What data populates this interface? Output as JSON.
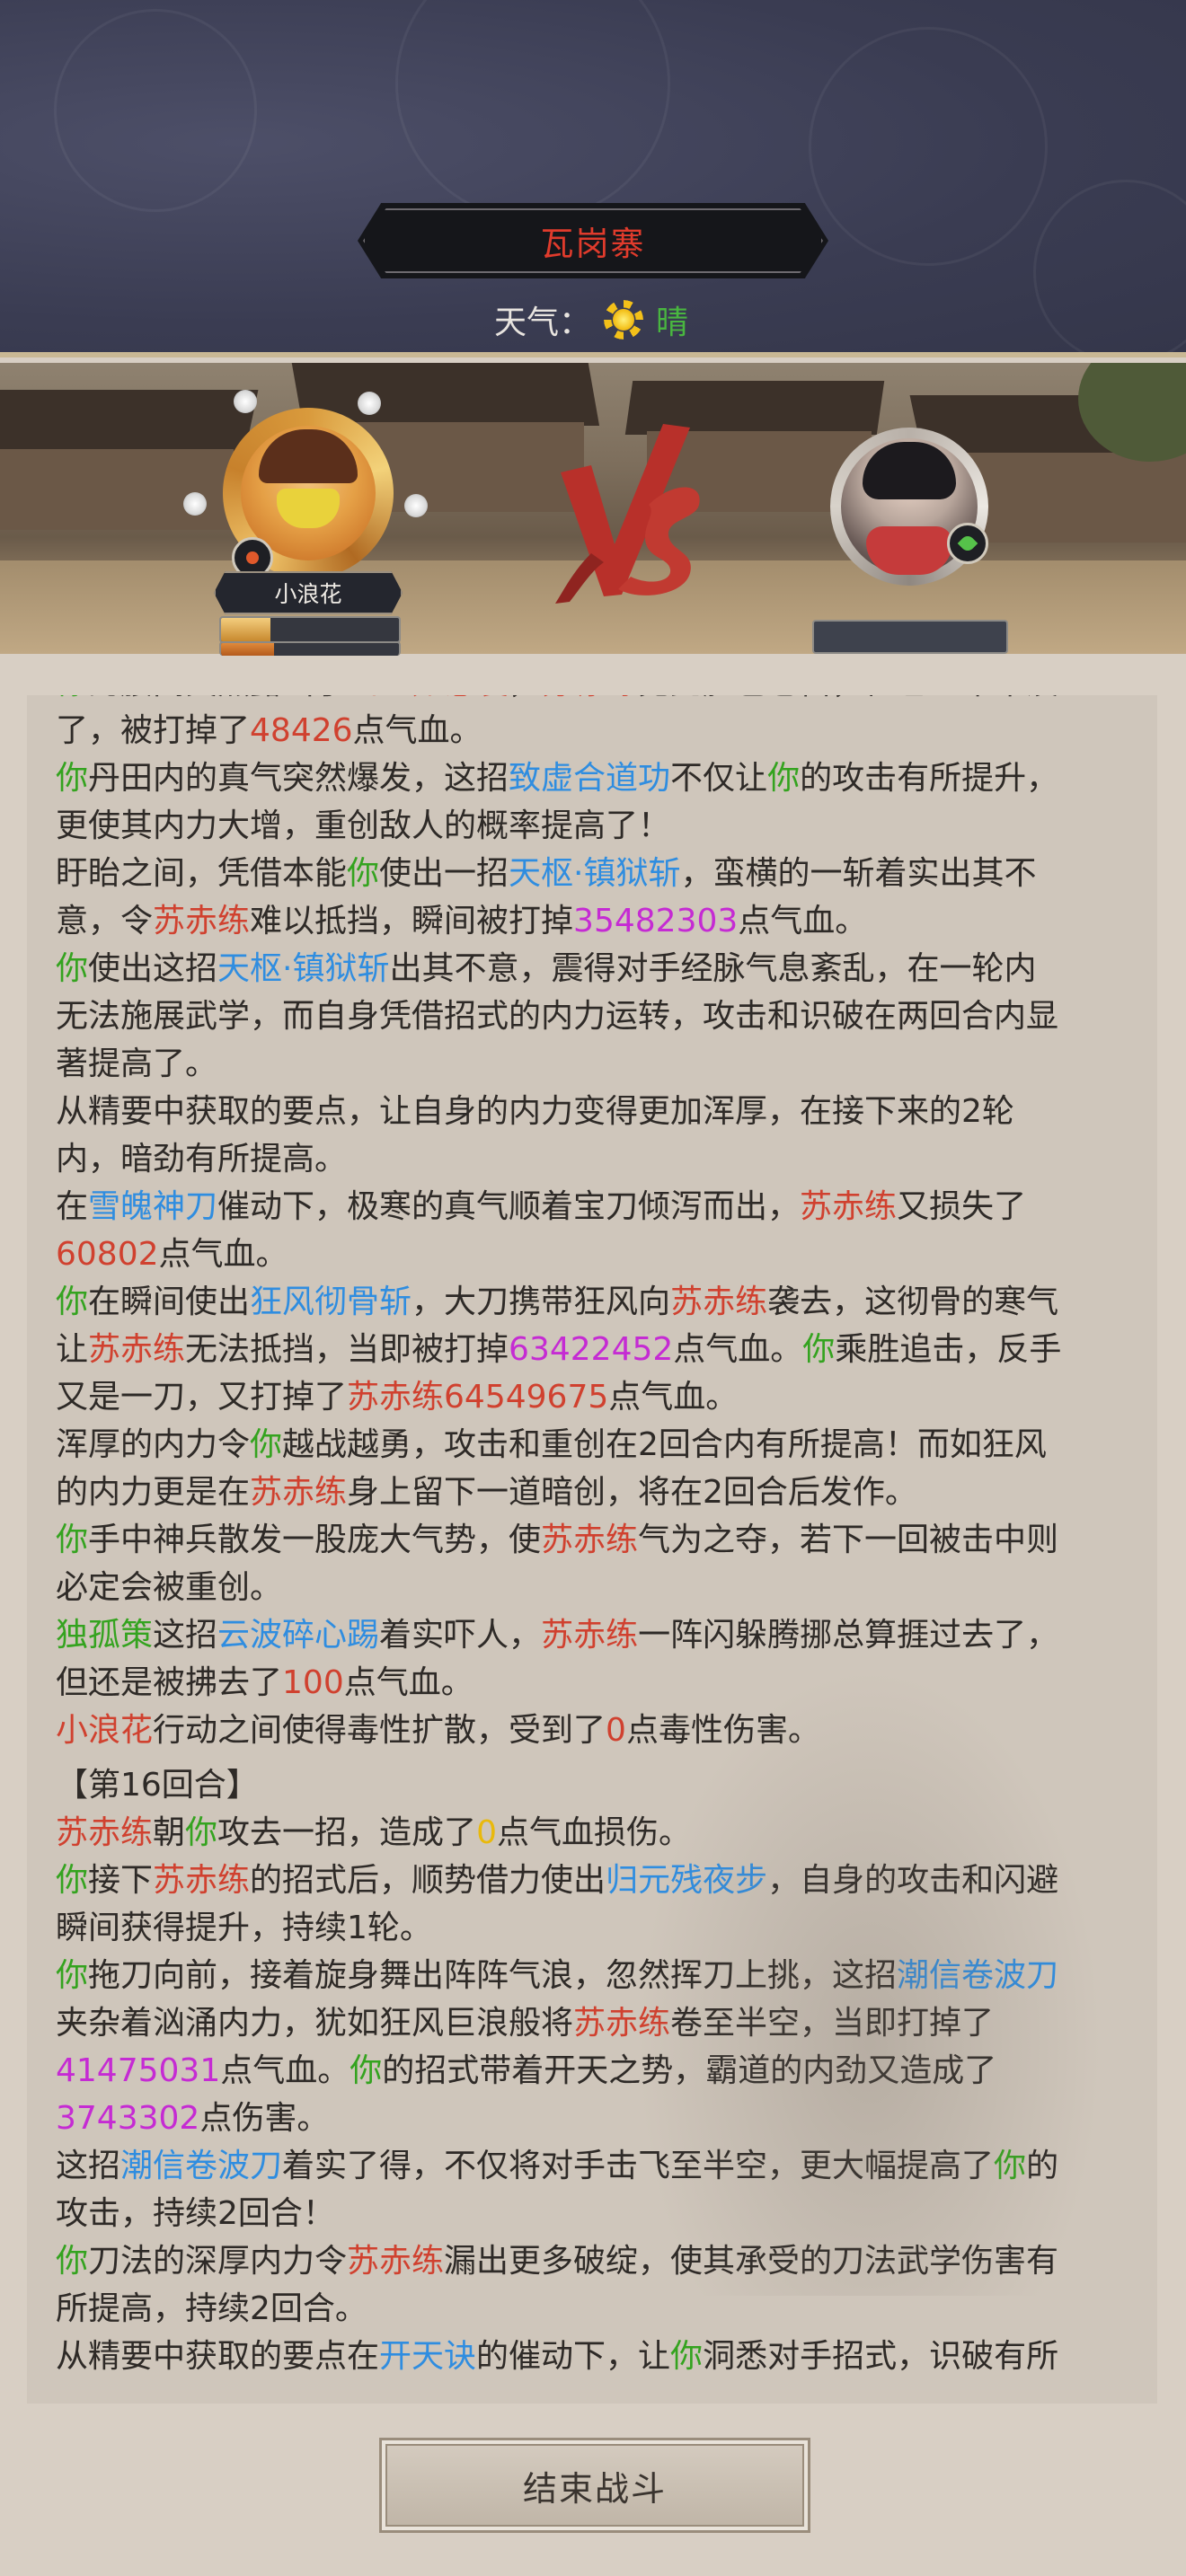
{
  "header": {
    "location": "瓦岗寨",
    "weather_label": "天气：",
    "weather_value": "晴",
    "weather_icon": "sun-icon"
  },
  "battle": {
    "player_name": "小浪花",
    "vs_label": "VS"
  },
  "colors": {
    "self": "#34a31f",
    "enemy": "#d0412f",
    "skill": "#2f8de0",
    "damage": "#c52bd3",
    "zero_damage": "#e9b90c"
  },
  "log": [
    [
      [
        "c-green",
        "你"
      ],
      [
        "",
        "的腰间突然露出了"
      ],
      [
        "c-red",
        "飞蝗如意囊"
      ],
      [
        "",
        "，"
      ],
      [
        "c-red",
        "苏赤练"
      ],
      [
        "",
        "见此脸色苍白，但已经来不及"
      ]
    ],
    [
      [
        "",
        "了，被打掉了"
      ],
      [
        "c-red",
        "48426"
      ],
      [
        "",
        "点气血。"
      ]
    ],
    [
      [
        "c-green",
        "你"
      ],
      [
        "",
        "丹田内的真气突然爆发，这招"
      ],
      [
        "c-blue",
        "致虚合道功"
      ],
      [
        "",
        "不仅让"
      ],
      [
        "c-green",
        "你"
      ],
      [
        "",
        "的攻击有所提升，"
      ]
    ],
    [
      [
        "",
        "更使其内力大增，重创敌人的概率提高了！"
      ]
    ],
    [
      [
        "",
        "盱眙之间，凭借本能"
      ],
      [
        "c-green",
        "你"
      ],
      [
        "",
        "使出一招"
      ],
      [
        "c-blue",
        "天枢·镇狱斩"
      ],
      [
        "",
        "，蛮横的一斩着实出其不"
      ]
    ],
    [
      [
        "",
        "意，令"
      ],
      [
        "c-red",
        "苏赤练"
      ],
      [
        "",
        "难以抵挡，瞬间被打掉"
      ],
      [
        "c-magenta",
        "35482303"
      ],
      [
        "",
        "点气血。"
      ]
    ],
    [
      [
        "c-green",
        "你"
      ],
      [
        "",
        "使出这招"
      ],
      [
        "c-blue",
        "天枢·镇狱斩"
      ],
      [
        "",
        "出其不意，震得对手经脉气息紊乱，在一轮内"
      ]
    ],
    [
      [
        "",
        "无法施展武学，而自身凭借招式的内力运转，攻击和识破在两回合内显"
      ]
    ],
    [
      [
        "",
        "著提高了。"
      ]
    ],
    [
      [
        "",
        "从精要中获取的要点，让自身的内力变得更加浑厚，在接下来的2轮"
      ]
    ],
    [
      [
        "",
        "内，暗劲有所提高。"
      ]
    ],
    [
      [
        "",
        "在"
      ],
      [
        "c-blue",
        "雪魄神刀"
      ],
      [
        "",
        "催动下，极寒的真气顺着宝刀倾泻而出，"
      ],
      [
        "c-red",
        "苏赤练"
      ],
      [
        "",
        "又损失了"
      ]
    ],
    [
      [
        "c-red",
        "60802"
      ],
      [
        "",
        "点气血。"
      ]
    ],
    [
      [
        "c-green",
        "你"
      ],
      [
        "",
        "在瞬间使出"
      ],
      [
        "c-blue",
        "狂风彻骨斩"
      ],
      [
        "",
        "，大刀携带狂风向"
      ],
      [
        "c-red",
        "苏赤练"
      ],
      [
        "",
        "袭去，这彻骨的寒气"
      ]
    ],
    [
      [
        "",
        "让"
      ],
      [
        "c-red",
        "苏赤练"
      ],
      [
        "",
        "无法抵挡，当即被打掉"
      ],
      [
        "c-magenta",
        "63422452"
      ],
      [
        "",
        "点气血。"
      ],
      [
        "c-green",
        "你"
      ],
      [
        "",
        "乘胜追击，反手"
      ]
    ],
    [
      [
        "",
        "又是一刀，又打掉了"
      ],
      [
        "c-red",
        "苏赤练64549675"
      ],
      [
        "",
        "点气血。"
      ]
    ],
    [
      [
        "",
        "浑厚的内力令"
      ],
      [
        "c-green",
        "你"
      ],
      [
        "",
        "越战越勇，攻击和重创在2回合内有所提高！而如狂风"
      ]
    ],
    [
      [
        "",
        "的内力更是在"
      ],
      [
        "c-red",
        "苏赤练"
      ],
      [
        "",
        "身上留下一道暗创，将在2回合后发作。"
      ]
    ],
    [
      [
        "c-green",
        "你"
      ],
      [
        "",
        "手中神兵散发一股庞大气势，使"
      ],
      [
        "c-red",
        "苏赤练"
      ],
      [
        "",
        "气为之夺，若下一回被击中则"
      ]
    ],
    [
      [
        "",
        "必定会被重创。"
      ]
    ],
    [
      [
        "c-green",
        "独孤策"
      ],
      [
        "",
        "这招"
      ],
      [
        "c-blue",
        "云波碎心踢"
      ],
      [
        "",
        "着实吓人，"
      ],
      [
        "c-red",
        "苏赤练"
      ],
      [
        "",
        "一阵闪躲腾挪总算捱过去了，"
      ]
    ],
    [
      [
        "",
        "但还是被拂去了"
      ],
      [
        "c-red",
        "100"
      ],
      [
        "",
        "点气血。"
      ]
    ],
    [
      [
        "c-red",
        "小浪花"
      ],
      [
        "",
        "行动之间使得毒性扩散，受到了"
      ],
      [
        "c-red",
        "0"
      ],
      [
        "",
        "点毒性伤害。"
      ]
    ],
    [
      [
        "",
        "【第16回合】"
      ]
    ],
    [
      [
        "c-red",
        "苏赤练"
      ],
      [
        "",
        "朝"
      ],
      [
        "c-green",
        "你"
      ],
      [
        "",
        "攻去一招，造成了"
      ],
      [
        "c-orange",
        "0"
      ],
      [
        "",
        "点气血损伤。"
      ]
    ],
    [
      [
        "c-green",
        "你"
      ],
      [
        "",
        "接下"
      ],
      [
        "c-red",
        "苏赤练"
      ],
      [
        "",
        "的招式后，顺势借力使出"
      ],
      [
        "c-blue",
        "归元残夜步"
      ],
      [
        "",
        "，自身的攻击和闪避"
      ]
    ],
    [
      [
        "",
        "瞬间获得提升，持续1轮。"
      ]
    ],
    [
      [
        "c-green",
        "你"
      ],
      [
        "",
        "拖刀向前，接着旋身舞出阵阵气浪，忽然挥刀上挑，这招"
      ],
      [
        "c-blue",
        "潮信卷波刀"
      ]
    ],
    [
      [
        "",
        "夹杂着汹涌内力，犹如狂风巨浪般将"
      ],
      [
        "c-red",
        "苏赤练"
      ],
      [
        "",
        "卷至半空，当即打掉了"
      ]
    ],
    [
      [
        "c-magenta",
        "41475031"
      ],
      [
        "",
        "点气血。"
      ],
      [
        "c-green",
        "你"
      ],
      [
        "",
        "的招式带着开天之势，霸道的内劲又造成了"
      ]
    ],
    [
      [
        "c-magenta",
        "3743302"
      ],
      [
        "",
        "点伤害。"
      ]
    ],
    [
      [
        "",
        "这招"
      ],
      [
        "c-blue",
        "潮信卷波刀"
      ],
      [
        "",
        "着实了得，不仅将对手击飞至半空，更大幅提高了"
      ],
      [
        "c-green",
        "你"
      ],
      [
        "",
        "的"
      ]
    ],
    [
      [
        "",
        "攻击，持续2回合！"
      ]
    ],
    [
      [
        "c-green",
        "你"
      ],
      [
        "",
        "刀法的深厚内力令"
      ],
      [
        "c-red",
        "苏赤练"
      ],
      [
        "",
        "漏出更多破绽，使其承受的刀法武学伤害有"
      ]
    ],
    [
      [
        "",
        "所提高，持续2回合。"
      ]
    ],
    [
      [
        "",
        "从精要中获取的要点在"
      ],
      [
        "c-blue",
        "开天诀"
      ],
      [
        "",
        "的催动下，让"
      ],
      [
        "c-green",
        "你"
      ],
      [
        "",
        "洞悉对手招式，识破有所"
      ]
    ]
  ],
  "footer": {
    "end_battle_label": "结束战斗"
  }
}
